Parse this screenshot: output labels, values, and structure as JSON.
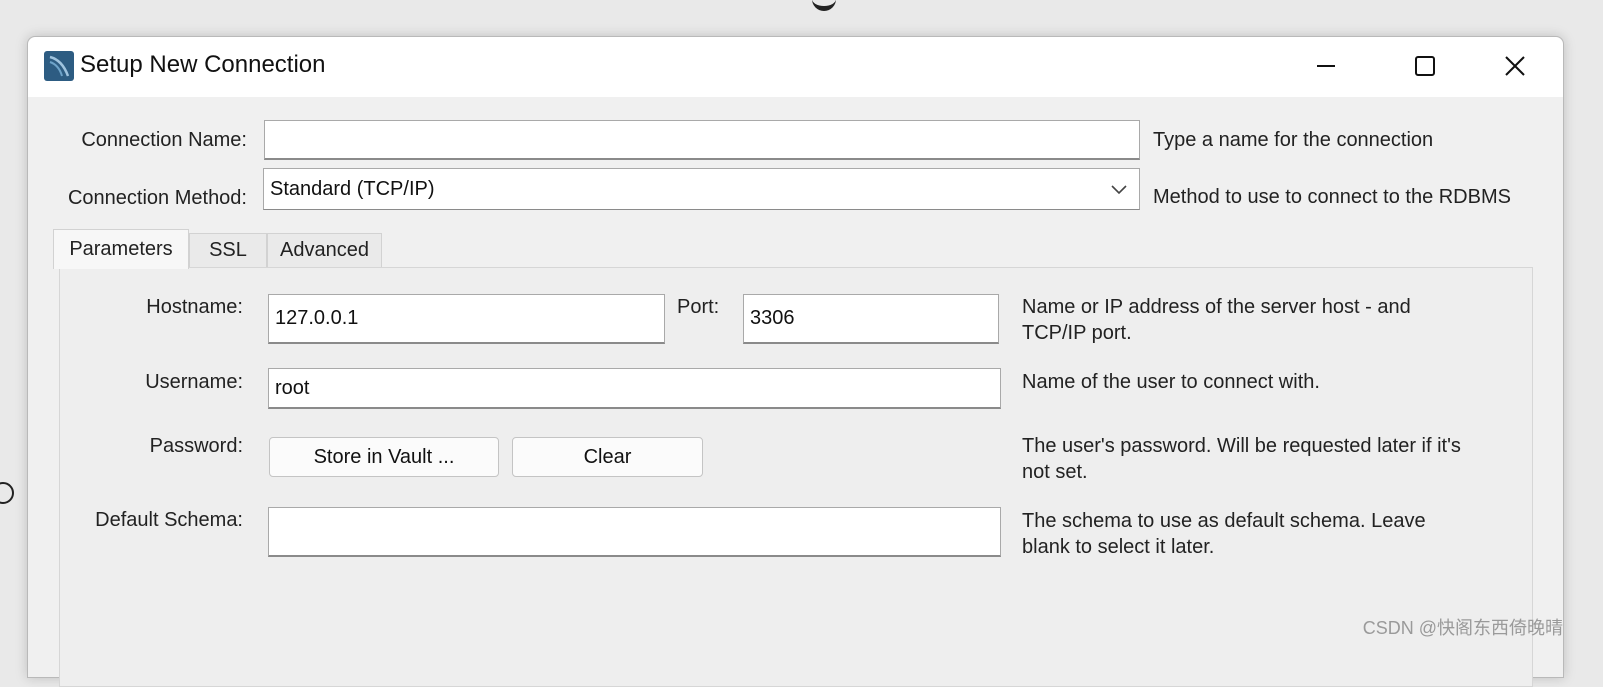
{
  "window": {
    "title": "Setup New Connection"
  },
  "connection_name": {
    "label": "Connection Name:",
    "value": "",
    "help": "Type a name for the connection"
  },
  "connection_method": {
    "label": "Connection Method:",
    "value": "Standard (TCP/IP)",
    "help": "Method to use to connect to the RDBMS"
  },
  "tabs": [
    {
      "label": "Parameters",
      "active": true
    },
    {
      "label": "SSL",
      "active": false
    },
    {
      "label": "Advanced",
      "active": false
    }
  ],
  "parameters": {
    "hostname": {
      "label": "Hostname:",
      "value": "127.0.0.1"
    },
    "port": {
      "label": "Port:",
      "value": "3306"
    },
    "host_help_1": "Name or IP address of the server host - and",
    "host_help_2": "TCP/IP port.",
    "username": {
      "label": "Username:",
      "value": "root",
      "help": "Name of the user to connect with."
    },
    "password": {
      "label": "Password:",
      "store_button": "Store in Vault ...",
      "clear_button": "Clear",
      "help_1": "The user's password. Will be requested later if it's",
      "help_2": "not set."
    },
    "default_schema": {
      "label": "Default Schema:",
      "value": "",
      "help_1": "The schema to use as default schema. Leave",
      "help_2": "blank to select it later."
    }
  },
  "watermark": "CSDN @快阁东西倚晚晴",
  "colors": {
    "window_bg": "#f0f0f0",
    "titlebar_bg": "#ffffff",
    "icon_blue": "#2d5c82"
  },
  "icons": [
    "mysql-workbench-icon",
    "minimize-icon",
    "maximize-icon",
    "close-icon",
    "chevron-down-icon"
  ]
}
